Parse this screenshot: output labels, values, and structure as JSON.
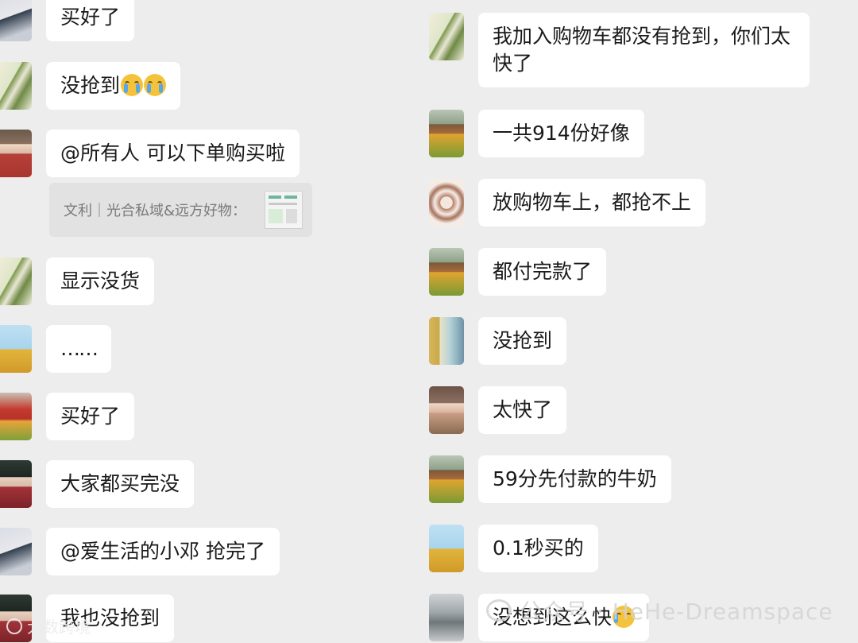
{
  "left_messages": [
    {
      "text": "买好了",
      "avatar": "avatar-girl-sitting"
    },
    {
      "text": "没抢到",
      "avatar": "avatar-bamboo",
      "emoji": "crying-face-icon",
      "emoji_count": 2
    },
    {
      "text": "@所有人  可以下单购买啦",
      "avatar": "avatar-woman-red"
    },
    {
      "text": "显示没货",
      "avatar": "avatar-bamboo"
    },
    {
      "text": "……",
      "avatar": "avatar-girl-hat"
    },
    {
      "text": "买好了",
      "avatar": "avatar-red-field"
    },
    {
      "text": "大家都买完没",
      "avatar": "avatar-woman-portrait"
    },
    {
      "text": "@爱生活的小邓 抢完了",
      "avatar": "avatar-girl-sitting"
    },
    {
      "text": "我也没抢到",
      "avatar": "avatar-woman-portrait"
    }
  ],
  "quote": {
    "text": "文利｜光合私域&远方好物："
  },
  "right_messages": [
    {
      "text": "我加入购物车都没有抢到，你们太快了",
      "line1": "我加入购物车都没有抢到，你们太",
      "line2": "快了",
      "avatar": "avatar-bamboo"
    },
    {
      "text": "一共914份好像",
      "avatar": "avatar-red-field"
    },
    {
      "text": "放购物车上，都抢不上",
      "avatar": "avatar-cookies"
    },
    {
      "text": "都付完款了",
      "avatar": "avatar-red-field"
    },
    {
      "text": "没抢到",
      "avatar": "avatar-girl-shelves"
    },
    {
      "text": "太快了",
      "avatar": "avatar-woman-room"
    },
    {
      "text": "59分先付款的牛奶",
      "avatar": "avatar-red-field"
    },
    {
      "text": "0.1秒买的",
      "avatar": "avatar-girl-hat"
    },
    {
      "text": "没想到这么快",
      "avatar": "avatar-temple",
      "emoji": "laughing-crying-face-icon"
    }
  ],
  "watermark": {
    "text": "公众号 · HeHe-Dreamspace"
  },
  "brand": {
    "text": "大数跨境"
  },
  "colors": {
    "background": "#ededed",
    "bubble": "#ffffff",
    "text": "#1a1a1a",
    "quote_bg": "#e2e2e2"
  }
}
